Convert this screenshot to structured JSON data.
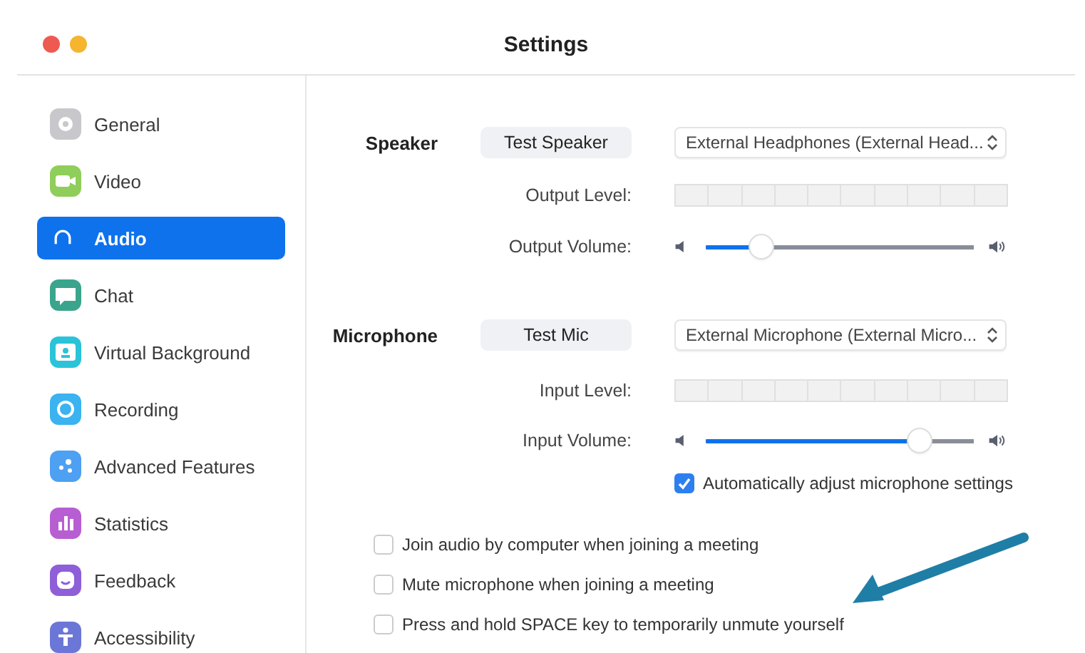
{
  "window": {
    "title": "Settings"
  },
  "sidebar": {
    "items": [
      {
        "label": "General",
        "selected": false,
        "color": "#c8c8cc"
      },
      {
        "label": "Video",
        "selected": false,
        "color": "#8fce5a"
      },
      {
        "label": "Audio",
        "selected": true,
        "color": "#ffffff"
      },
      {
        "label": "Chat",
        "selected": false,
        "color": "#3aa58c"
      },
      {
        "label": "Virtual Background",
        "selected": false,
        "color": "#2bc3d8"
      },
      {
        "label": "Recording",
        "selected": false,
        "color": "#3ab3f0"
      },
      {
        "label": "Advanced Features",
        "selected": false,
        "color": "#4ea0f2"
      },
      {
        "label": "Statistics",
        "selected": false,
        "color": "#b75fd2"
      },
      {
        "label": "Feedback",
        "selected": false,
        "color": "#8e5fd8"
      },
      {
        "label": "Accessibility",
        "selected": false,
        "color": "#6b77d6"
      }
    ]
  },
  "speaker": {
    "title": "Speaker",
    "test_button": "Test Speaker",
    "device": "External Headphones (External Head...",
    "level_label": "Output Level:",
    "volume_label": "Output Volume:",
    "volume": {
      "level": 0.21
    }
  },
  "microphone": {
    "title": "Microphone",
    "test_button": "Test Mic",
    "device": "External Microphone (External Micro...",
    "level_label": "Input Level:",
    "volume_label": "Input Volume:",
    "volume": {
      "level": 0.8
    },
    "auto_adjust": {
      "label": "Automatically adjust microphone settings",
      "checked": true
    }
  },
  "options": [
    {
      "label": "Join audio by computer when joining a meeting",
      "checked": false
    },
    {
      "label": "Mute microphone when joining a meeting",
      "checked": false
    },
    {
      "label": "Press and hold SPACE key to temporarily unmute yourself",
      "checked": false
    }
  ]
}
